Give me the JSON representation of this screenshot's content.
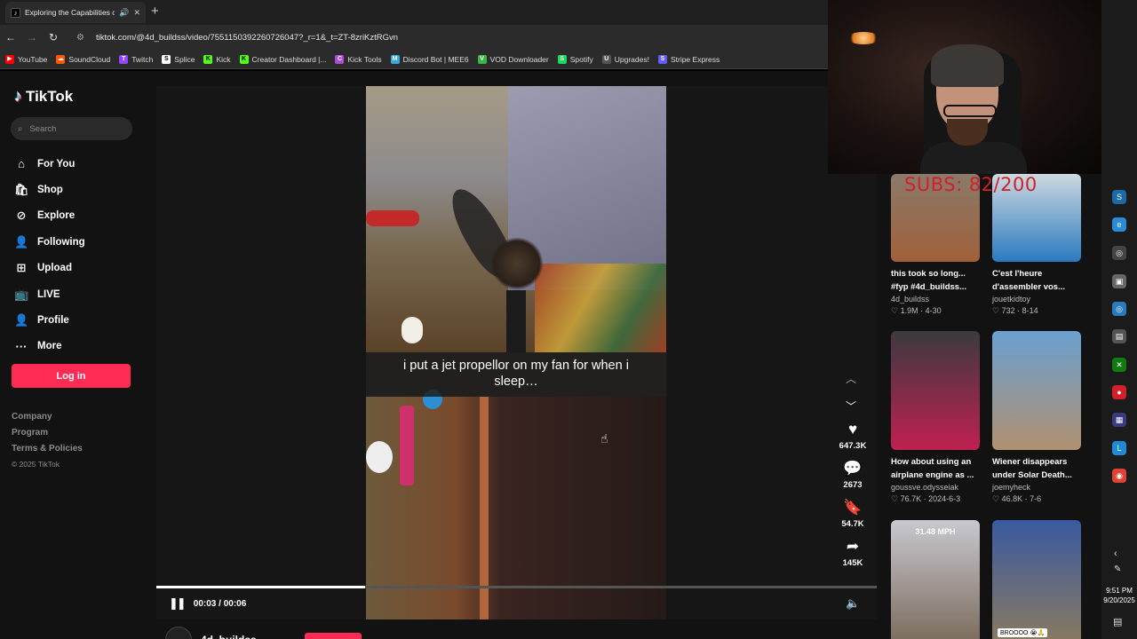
{
  "browser": {
    "tab_title": "Exploring the Capabilities o...",
    "tab_favicon": "tiktok-icon",
    "url": "tiktok.com/@4d_buildss/video/7551150392260726047?_r=1&_t=ZT-8zriKztRGvn",
    "bookmarks": [
      {
        "label": "YouTube",
        "color": "#ff0000",
        "glyph": "▶"
      },
      {
        "label": "SoundCloud",
        "color": "#ff5500",
        "glyph": "☁"
      },
      {
        "label": "Twitch",
        "color": "#9146ff",
        "glyph": "T"
      },
      {
        "label": "Splice",
        "color": "#ffffff",
        "glyph": "S"
      },
      {
        "label": "Kick",
        "color": "#53fc18",
        "glyph": "K"
      },
      {
        "label": "Creator Dashboard |...",
        "color": "#53fc18",
        "glyph": "K"
      },
      {
        "label": "Kick Tools",
        "color": "#b04bd6",
        "glyph": "C"
      },
      {
        "label": "Discord Bot | MEE6",
        "color": "#39a9db",
        "glyph": "M"
      },
      {
        "label": "VOD Downloader",
        "color": "#3bb54a",
        "glyph": "V"
      },
      {
        "label": "Spotify",
        "color": "#1ed760",
        "glyph": "S"
      },
      {
        "label": "Upgrades!",
        "color": "#555555",
        "glyph": "U"
      },
      {
        "label": "Stripe Express",
        "color": "#635bff",
        "glyph": "S"
      }
    ]
  },
  "sidebar": {
    "logo": "TikTok",
    "search_placeholder": "Search",
    "menu": [
      {
        "label": "For You",
        "icon": "⌂",
        "name": "home-icon"
      },
      {
        "label": "Shop",
        "icon": "🛍",
        "name": "shop-icon"
      },
      {
        "label": "Explore",
        "icon": "⊘",
        "name": "compass-icon"
      },
      {
        "label": "Following",
        "icon": "👤",
        "name": "following-icon"
      },
      {
        "label": "Upload",
        "icon": "⊞",
        "name": "upload-icon"
      },
      {
        "label": "LIVE",
        "icon": "📺",
        "name": "live-icon"
      },
      {
        "label": "Profile",
        "icon": "👤",
        "name": "profile-icon"
      },
      {
        "label": "More",
        "icon": "···",
        "name": "more-icon"
      }
    ],
    "login_label": "Log in",
    "footer": [
      "Company",
      "Program",
      "Terms & Policies"
    ],
    "copyright": "© 2025 TikTok"
  },
  "player": {
    "caption": "i put a jet propellor on my fan for when i sleep…",
    "time": "00:03 / 00:06",
    "progress_fraction": 0.5,
    "likes": "647.3K",
    "comments": "2673",
    "saves": "54.7K",
    "shares": "145K",
    "author": "4d_buildss"
  },
  "overlay": {
    "subs": "SUBS: 82/200"
  },
  "recommendations": [
    {
      "title": "this took so long...",
      "title2": "#fyp #4d_buildss...",
      "author": "4d_buildss",
      "views": "1.9M",
      "date": "4-30",
      "thumb_top": "#8a7a6a",
      "thumb_bottom": "#a0603a",
      "overlay": ""
    },
    {
      "title": "C'est l'heure",
      "title2": "d'assembler vos...",
      "author": "jouetkidtoy",
      "views": "732",
      "date": "8-14",
      "thumb_top": "#cdd8e0",
      "thumb_bottom": "#2a7ac0",
      "overlay": ""
    },
    {
      "title": "How about using an",
      "title2": "airplane engine as ...",
      "author": "goussve.odysseiak",
      "views": "76.7K",
      "date": "2024-6-3",
      "thumb_top": "#3a3a40",
      "thumb_bottom": "#c02050",
      "overlay": ""
    },
    {
      "title": "Wiener disappears",
      "title2": "under Solar Death...",
      "author": "joemyheck",
      "views": "46.8K",
      "date": "7-6",
      "thumb_top": "#6aa0d0",
      "thumb_bottom": "#b09070",
      "overlay": ""
    },
    {
      "title": "",
      "title2": "",
      "author": "",
      "views": "",
      "date": "",
      "thumb_top": "#c8c8d0",
      "thumb_bottom": "#7a6a5a",
      "overlay": "31.48 MPH"
    },
    {
      "title": "",
      "title2": "",
      "author": "",
      "views": "",
      "date": "",
      "thumb_top": "#3a5aa0",
      "thumb_bottom": "#8a7a60",
      "overlay": "",
      "overlay_bottom": "BROOOO 😭🙏"
    }
  ],
  "taskbar": {
    "time": "9:51 PM",
    "date": "9/20/2025",
    "icons": [
      {
        "name": "steam-icon",
        "color": "#1b6aa5",
        "glyph": "S"
      },
      {
        "name": "edge-icon",
        "color": "#2a8bd6",
        "glyph": "e"
      },
      {
        "name": "obs-icon",
        "color": "#444444",
        "glyph": "◎"
      },
      {
        "name": "controller-icon",
        "color": "#666666",
        "glyph": "▣"
      },
      {
        "name": "circle-app-icon",
        "color": "#2a7ac0",
        "glyph": "◎"
      },
      {
        "name": "printer-icon",
        "color": "#555555",
        "glyph": "▤"
      },
      {
        "name": "xbox-icon",
        "color": "#107c10",
        "glyph": "✕"
      },
      {
        "name": "red-app-icon",
        "color": "#d0202a",
        "glyph": "●"
      },
      {
        "name": "grid-app-icon",
        "color": "#3a3a80",
        "glyph": "▦"
      },
      {
        "name": "live-app-icon",
        "color": "#1e8ad6",
        "glyph": "L"
      },
      {
        "name": "chrome-icon",
        "color": "#dd4433",
        "glyph": "◉"
      }
    ]
  }
}
